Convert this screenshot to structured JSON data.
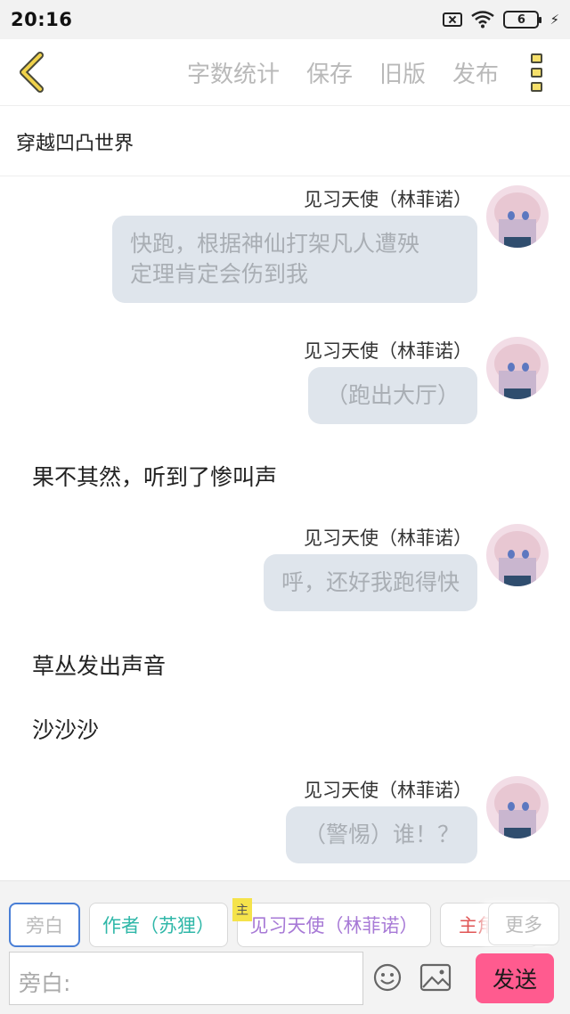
{
  "status_bar": {
    "time": "20:16",
    "battery_level": "6"
  },
  "toolbar": {
    "actions": [
      "字数统计",
      "保存",
      "旧版",
      "发布"
    ],
    "accent_color": "#e0c23a"
  },
  "story_title": "穿越凹凸世界",
  "chat": {
    "messages": [
      {
        "type": "character",
        "name": "见习天使（林菲诺）",
        "text_lines": [
          "快跑，根据神仙打架凡人遭殃",
          "定理肯定会伤到我"
        ]
      },
      {
        "type": "character",
        "name": "见习天使（林菲诺）",
        "text_lines": [
          "（跑出大厅）"
        ]
      },
      {
        "type": "narration",
        "text": "果不其然，听到了惨叫声"
      },
      {
        "type": "character",
        "name": "见习天使（林菲诺）",
        "text_lines": [
          "呼，还好我跑得快"
        ]
      },
      {
        "type": "narration",
        "text": "草丛发出声音"
      },
      {
        "type": "narration",
        "text": "沙沙沙"
      },
      {
        "type": "character",
        "name": "见习天使（林菲诺）",
        "text_lines": [
          "（警惕）谁！？"
        ]
      }
    ]
  },
  "roles": {
    "items": [
      {
        "label": "旁白",
        "color": "#b8b8b8"
      },
      {
        "label": "作者（苏狸）",
        "color": "#2fb7a8"
      },
      {
        "label": "见习天使（林菲诺）",
        "color": "#a779d6",
        "tag": "主"
      },
      {
        "label": "主角",
        "color": "#e05555"
      }
    ],
    "more_label": "更多"
  },
  "input": {
    "placeholder": "旁白:",
    "send_label": "发送",
    "send_color": "#ff5b8f"
  }
}
